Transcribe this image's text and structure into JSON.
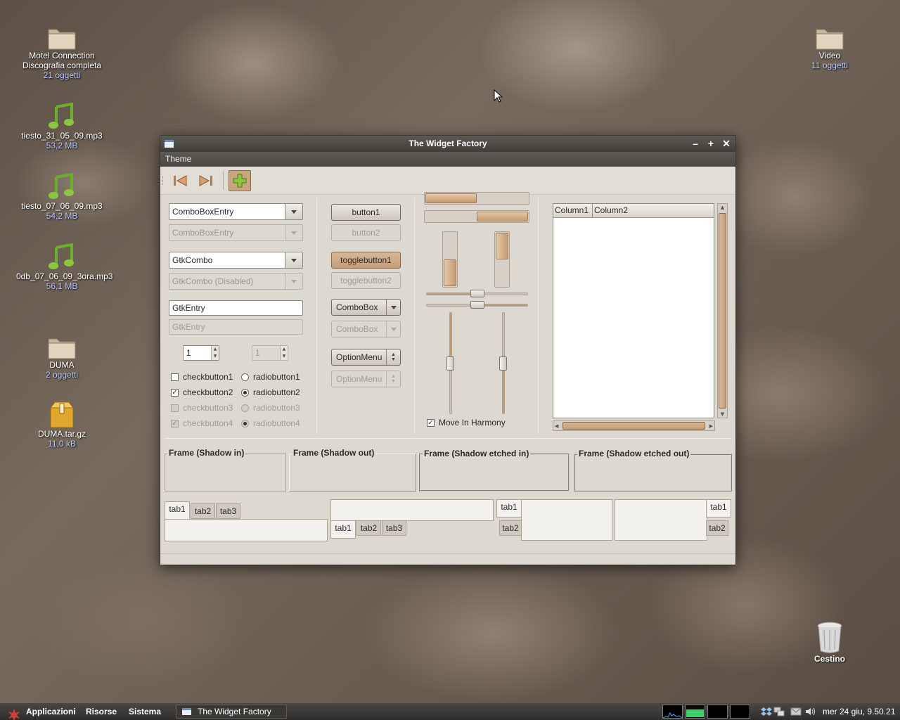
{
  "desktop": {
    "icons": [
      {
        "name": "Motel Connection Discografia completa",
        "meta": "21 oggetti",
        "icon": "folder-icon"
      },
      {
        "name": "tiesto_31_05_09.mp3",
        "meta": "53,2 MB",
        "icon": "music-icon"
      },
      {
        "name": "tiesto_07_06_09.mp3",
        "meta": "54,2 MB",
        "icon": "music-icon"
      },
      {
        "name": "0db_07_06_09_3ora.mp3",
        "meta": "56,1 MB",
        "icon": "music-icon"
      },
      {
        "name": "DUMA",
        "meta": "2 oggetti",
        "icon": "folder-icon"
      },
      {
        "name": "DUMA.tar.gz",
        "meta": "11,0 kB",
        "icon": "archive-icon"
      },
      {
        "name": "Video",
        "meta": "11 oggetti",
        "icon": "folder-icon"
      },
      {
        "name": "Cestino",
        "meta": "",
        "icon": "trash-icon"
      }
    ]
  },
  "window": {
    "title": "The Widget Factory",
    "menu": [
      "Theme"
    ],
    "toolbar": {
      "buttons": [
        "first-icon",
        "last-icon",
        "add-icon"
      ]
    },
    "combos": {
      "combo_entry": "ComboBoxEntry",
      "combo_entry_dis": "ComboBoxEntry",
      "gtk_combo": "GtkCombo",
      "gtk_combo_dis": "GtkCombo (Disabled)"
    },
    "entries": {
      "entry": "GtkEntry",
      "entry_dis": "GtkEntry"
    },
    "spins": {
      "spin": "1",
      "spin_dis": "1"
    },
    "checks": [
      {
        "label": "checkbutton1",
        "checked": false,
        "disabled": false
      },
      {
        "label": "checkbutton2",
        "checked": true,
        "disabled": false
      },
      {
        "label": "checkbutton3",
        "checked": false,
        "disabled": true
      },
      {
        "label": "checkbutton4",
        "checked": true,
        "disabled": true
      }
    ],
    "radios": [
      {
        "label": "radiobutton1",
        "checked": false,
        "disabled": false
      },
      {
        "label": "radiobutton2",
        "checked": true,
        "disabled": false
      },
      {
        "label": "radiobutton3",
        "checked": false,
        "disabled": true
      },
      {
        "label": "radiobutton4",
        "checked": true,
        "disabled": true
      }
    ],
    "buttons": {
      "button1": "button1",
      "button2": "button2",
      "toggle1": "togglebutton1",
      "toggle2": "togglebutton2",
      "combobox": "ComboBox",
      "combobox_dis": "ComboBox",
      "optionmenu": "OptionMenu",
      "optionmenu_dis": "OptionMenu"
    },
    "progress": {
      "h1": 0.5,
      "h2": 0.5,
      "v1": 0.5,
      "v2": 0.5
    },
    "sliders": {
      "h1": 0.5,
      "h2": 0.5,
      "v1": 0.5,
      "v2": 0.5
    },
    "harmony": {
      "label": "Move In Harmony",
      "checked": true
    },
    "tree": {
      "columns": [
        "Column1",
        "Column2"
      ]
    },
    "frames": [
      "Frame (Shadow in)",
      "Frame (Shadow out)",
      "Frame (Shadow etched in)",
      "Frame (Shadow etched out)"
    ],
    "tabs": [
      "tab1",
      "tab2",
      "tab3"
    ]
  },
  "taskbar": {
    "menus": [
      "Applicazioni",
      "Risorse",
      "Sistema"
    ],
    "task": "The Widget Factory",
    "clock": "mer 24 giu, 9.50.21"
  }
}
